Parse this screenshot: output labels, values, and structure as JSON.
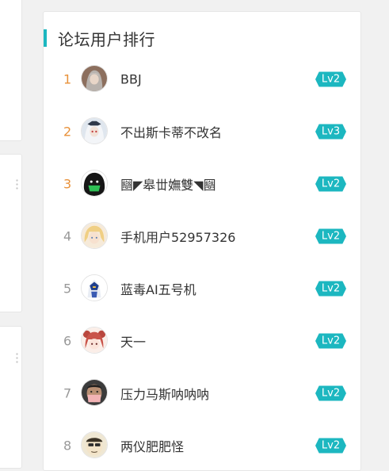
{
  "panel": {
    "title": "论坛用户排行"
  },
  "colors": {
    "accent": "#1cb7c0",
    "top_rank": "#e8913a",
    "rank": "#999999",
    "text": "#333333"
  },
  "ranking": [
    {
      "rank": "1",
      "name": "BBJ",
      "level": "Lv2",
      "avatar_icon": "gray-haired-girl-avatar"
    },
    {
      "rank": "2",
      "name": "不出斯卡蒂不改名",
      "level": "Lv3",
      "avatar_icon": "white-haired-girl-avatar"
    },
    {
      "rank": "3",
      "name": "圝◤皋丗嫵雙◥圝",
      "level": "Lv2",
      "avatar_icon": "masked-green-face-avatar"
    },
    {
      "rank": "4",
      "name": "手机用户52957326",
      "level": "Lv2",
      "avatar_icon": "blonde-character-avatar"
    },
    {
      "rank": "5",
      "name": "蓝毒AI五号机",
      "level": "Lv2",
      "avatar_icon": "mecha-robot-avatar"
    },
    {
      "rank": "6",
      "name": "天一",
      "level": "Lv2",
      "avatar_icon": "red-haired-girl-avatar"
    },
    {
      "rank": "7",
      "name": "压力马斯呐呐呐",
      "level": "Lv2",
      "avatar_icon": "masked-man-avatar"
    },
    {
      "rank": "8",
      "name": "两仪肥肥怪",
      "level": "Lv2",
      "avatar_icon": "cartoon-guy-avatar"
    }
  ]
}
